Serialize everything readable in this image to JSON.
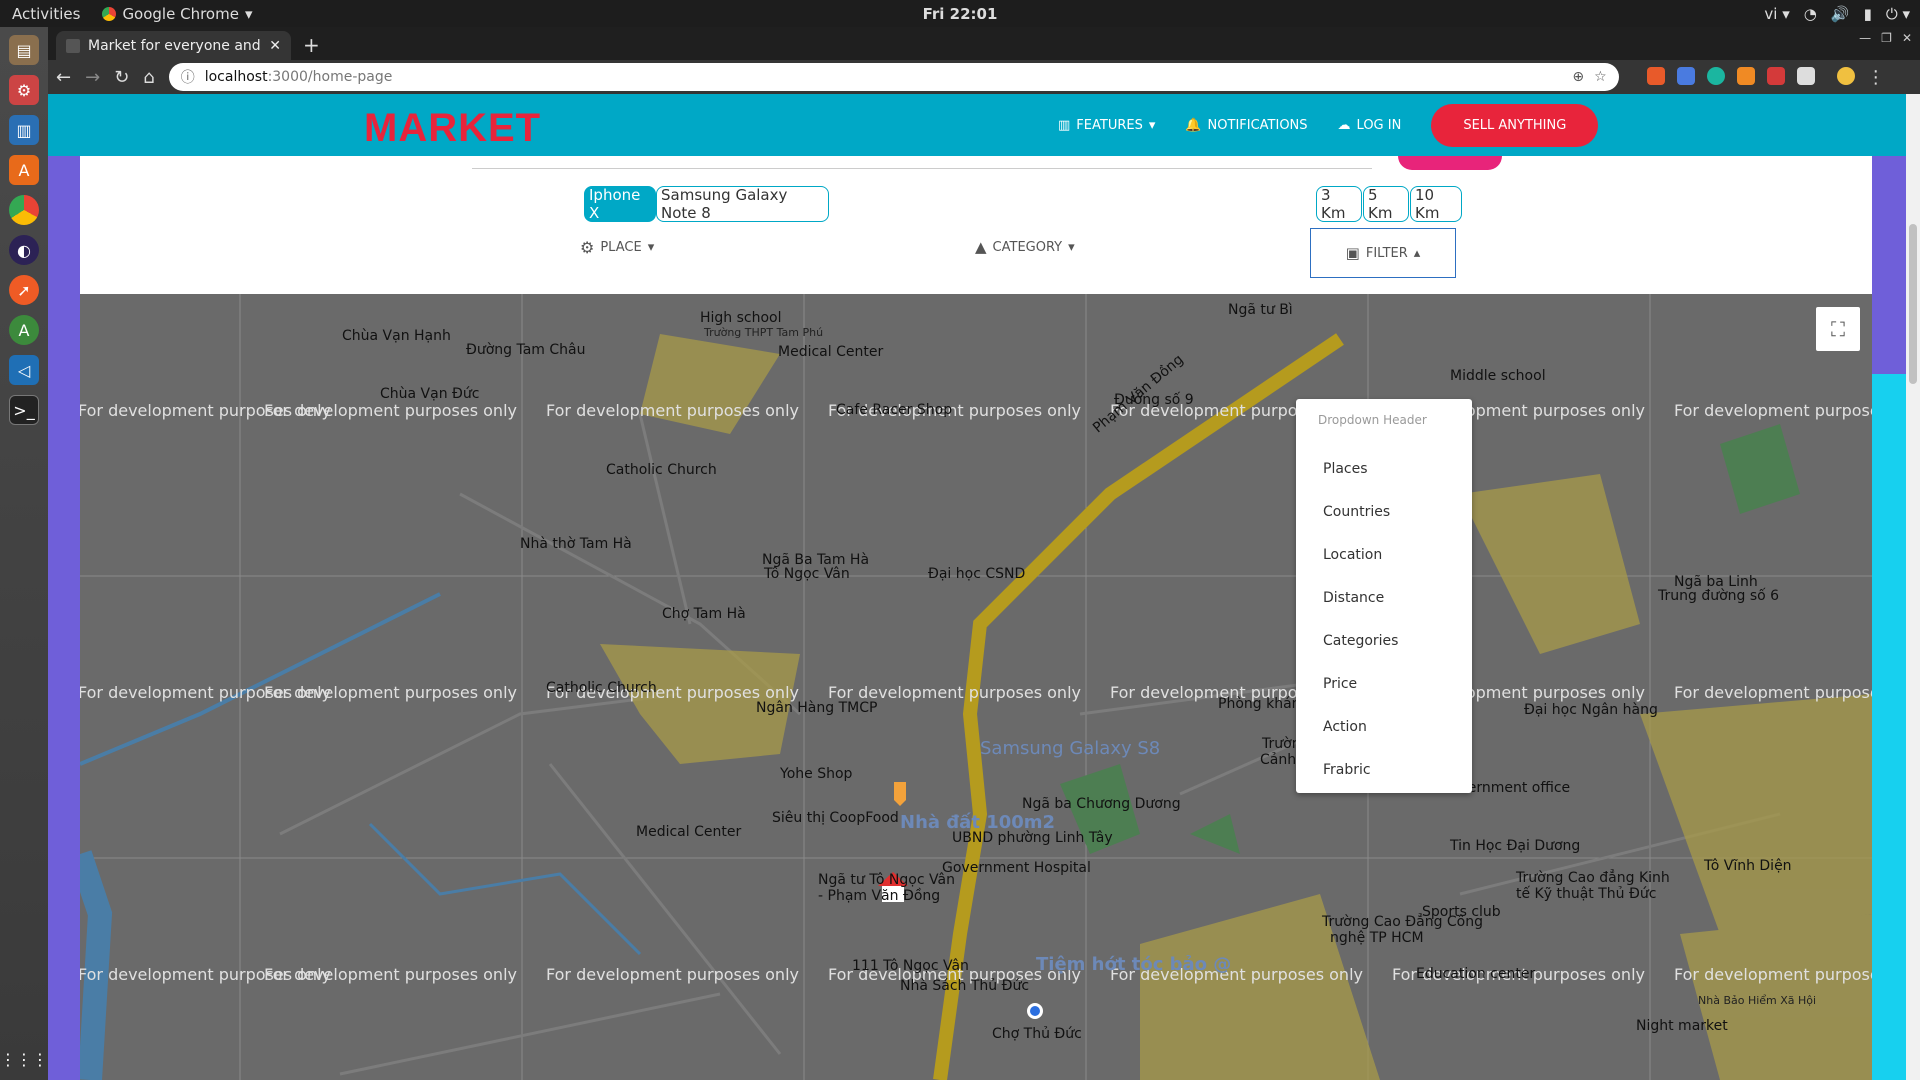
{
  "os": {
    "activities": "Activities",
    "app_name": "Google Chrome",
    "clock": "Fri 22:01",
    "lang": "vi"
  },
  "browser": {
    "tab_title": "Market for everyone and ev",
    "url_host": "localhost",
    "url_rest": ":3000/home-page"
  },
  "navbar": {
    "logo": "MARKET",
    "features": "FEATURES",
    "notifications": "NOTIFICATIONS",
    "login": "LOG IN",
    "sell": "SELL ANYTHING"
  },
  "filters": {
    "chips": [
      "Iphone X",
      "Samsung Galaxy Note 8"
    ],
    "distances": [
      "3 Km",
      "5 Km",
      "10 Km"
    ],
    "place": "PLACE",
    "category": "CATEGORY",
    "filter": "FILTER"
  },
  "dropdown": {
    "header": "Dropdown Header",
    "items": [
      "Places",
      "Countries",
      "Location",
      "Distance",
      "Categories",
      "Price",
      "Action",
      "Frabric"
    ]
  },
  "map": {
    "watermark": "For development purposes only",
    "labels": [
      "High school",
      "Trường THPT Tam Phú",
      "Medical Center",
      "Chùa Vạn Hạnh",
      "Đường Tam Châu",
      "Chùa Vạn Đức",
      "Cafe Racer Shop",
      "Catholic Church",
      "Nhà thờ Tam Hà",
      "Ngã Ba Tam Hà",
      "Tô Ngọc Vân",
      "Đại học CSND",
      "Chợ Tam Hà",
      "Catholic Church",
      "Ngân Hàng TMCP",
      "Yohe Shop",
      "Siêu thị CoopFood",
      "Medical Center",
      "Samsung Galaxy S8",
      "Nhà đất 100m2",
      "Ngã ba Chương Dương",
      "UBND phường Linh Tây",
      "Government Hospital",
      "Ngã tư Tô Ngọc Vân",
      "- Phạm Văn Đồng",
      "111 Tô Ngọc Vân",
      "Nhà Sách Thủ Đức",
      "Tiệm hớt tóc bảo @",
      "Chợ Thủ Đức",
      "Middle school",
      "Ngã ba Linh",
      "Trung đường số 6",
      "Phòng khám",
      "Trường Đại Học",
      "Cảnh Sát Nhân Dân",
      "Đại học Ngân hàng",
      "Government office",
      "Tin Học Đại Dương",
      "Trường Cao đẳng Kinh",
      "tế Kỹ thuật Thủ Đức",
      "Tô Vĩnh Diện",
      "Trường Cao Đẳng Công",
      "nghệ TP HCM",
      "Sports club",
      "Education center",
      "Night market",
      "Phạm Văn Đồng",
      "Ngã tư Bì",
      "Đường số 9",
      "Nhà Bảo Hiểm Xã Hội"
    ]
  }
}
